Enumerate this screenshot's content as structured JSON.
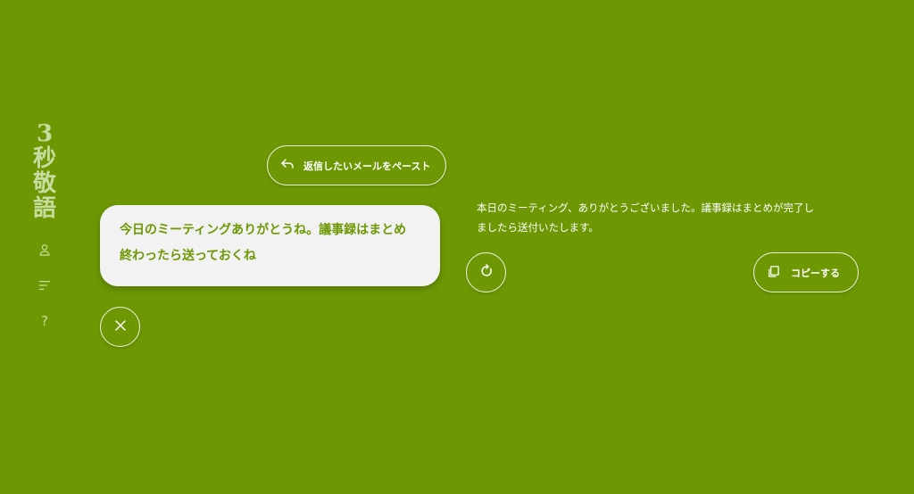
{
  "app": {
    "logo_chars": [
      "3",
      "秒",
      "敬",
      "語"
    ]
  },
  "sidebar": {
    "items": [
      {
        "icon": "person-icon"
      },
      {
        "icon": "menu-lines-icon"
      },
      {
        "icon": "help-question-icon",
        "label": "?"
      }
    ]
  },
  "paste_button": {
    "icon": "reply-arrow-icon",
    "label": "返信したいメールをペースト"
  },
  "input": {
    "lines": [
      "今日のミーティングありがとうね。議事録はまとめ",
      "終わったら送っておくね"
    ]
  },
  "close_button": {
    "icon": "close-x-icon"
  },
  "output": {
    "lines": [
      "本日のミーティング、ありがとうございました。議事録はまとめが完了し",
      "ましたら送付いたします。"
    ]
  },
  "refresh_button": {
    "icon": "refresh-icon"
  },
  "copy_button": {
    "icon": "copy-icon",
    "label": "コピーする"
  },
  "colors": {
    "background": "#6d9804",
    "card": "#f2f2f2",
    "accent_text": "#6d9804",
    "logo": "#c9dca0",
    "outline": "#e9f0d8"
  }
}
